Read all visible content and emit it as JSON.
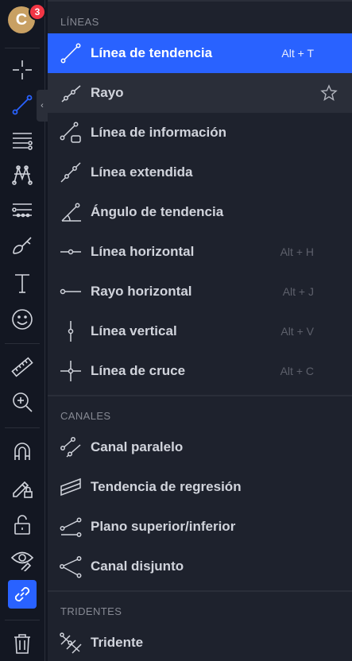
{
  "toolbar": {
    "avatar_letter": "C",
    "notification_count": "3",
    "collapse_glyph": "‹",
    "tools": [
      {
        "name": "crosshair-icon"
      },
      {
        "name": "trend-line-icon"
      },
      {
        "name": "fib-lines-icon"
      },
      {
        "name": "pattern-icon"
      },
      {
        "name": "projection-icon"
      },
      {
        "name": "brush-icon"
      },
      {
        "name": "text-icon"
      },
      {
        "name": "emoji-icon"
      },
      {
        "name": "ruler-icon"
      },
      {
        "name": "zoom-in-icon"
      },
      {
        "name": "magnet-icon"
      },
      {
        "name": "lock-drawing-icon"
      },
      {
        "name": "unlock-icon"
      },
      {
        "name": "eye-icon"
      },
      {
        "name": "link-icon"
      },
      {
        "name": "trash-icon"
      }
    ],
    "active_color": "#2962ff"
  },
  "menu": {
    "sections": [
      {
        "title": "LÍNEAS",
        "items": [
          {
            "label": "Línea de tendencia",
            "hotkey": "Alt + T",
            "icon": "trend-line-icon"
          },
          {
            "label": "Rayo",
            "hotkey": "",
            "icon": "ray-icon"
          },
          {
            "label": "Línea de información",
            "hotkey": "",
            "icon": "info-line-icon"
          },
          {
            "label": "Línea extendida",
            "hotkey": "",
            "icon": "extended-line-icon"
          },
          {
            "label": "Ángulo de tendencia",
            "hotkey": "",
            "icon": "trend-angle-icon"
          },
          {
            "label": "Línea horizontal",
            "hotkey": "Alt + H",
            "icon": "horizontal-line-icon"
          },
          {
            "label": "Rayo horizontal",
            "hotkey": "Alt + J",
            "icon": "horizontal-ray-icon"
          },
          {
            "label": "Línea vertical",
            "hotkey": "Alt + V",
            "icon": "vertical-line-icon"
          },
          {
            "label": "Línea de cruce",
            "hotkey": "Alt + C",
            "icon": "cross-line-icon"
          }
        ]
      },
      {
        "title": "CANALES",
        "items": [
          {
            "label": "Canal paralelo",
            "icon": "parallel-channel-icon"
          },
          {
            "label": "Tendencia de regresión",
            "icon": "regression-trend-icon"
          },
          {
            "label": "Plano superior/inferior",
            "icon": "flat-top-bottom-icon"
          },
          {
            "label": "Canal disjunto",
            "icon": "disjoint-channel-icon"
          }
        ]
      },
      {
        "title": "TRIDENTES",
        "items": [
          {
            "label": "Tridente",
            "icon": "pitchfork-icon"
          }
        ]
      }
    ],
    "selected_color": "#2962ff",
    "hover_color": "#2a2e39"
  }
}
